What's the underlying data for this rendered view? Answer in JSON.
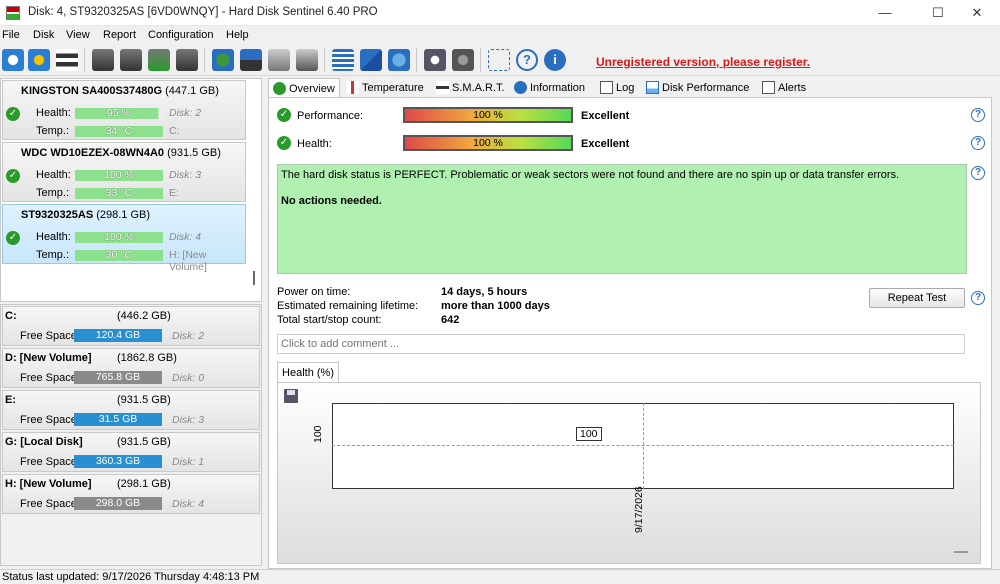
{
  "window": {
    "title": "Disk: 4, ST9320325AS [6VD0WNQY]  -  Hard Disk Sentinel 6.40 PRO",
    "minimize": "—",
    "maximize": "☐",
    "close": "✕"
  },
  "menu": [
    {
      "label": "File"
    },
    {
      "label": "Disk"
    },
    {
      "label": "View"
    },
    {
      "label": "Report"
    },
    {
      "label": "Configuration"
    },
    {
      "label": "Help"
    }
  ],
  "toolbar": {
    "unregistered": "Unregistered version, please register.",
    "icons": [
      "refresh-icon",
      "refresh-warning-icon",
      "disk-list-icon",
      "disk-info-icon",
      "disk-schedule-icon",
      "disk-test-icon",
      "disk-report-icon",
      "web-report-icon",
      "eject-icon",
      "usb-disk-icon",
      "external-disk-icon",
      "report-icon",
      "email-icon",
      "network-icon",
      "settings-icon",
      "sound-icon",
      "screenshot-icon",
      "help-icon",
      "about-icon"
    ]
  },
  "disks": [
    {
      "name": "KINGSTON SA400S37480G",
      "size": "(447.1 GB)",
      "health": "95 %",
      "health_pct": 95,
      "temp": "34 °C",
      "disk": "Disk: 2",
      "vol": "C:",
      "vol_italic": false
    },
    {
      "name": "WDC WD10EZEX-08WN4A0",
      "size": "(931.5 GB)",
      "health": "100 %",
      "health_pct": 100,
      "temp": "33 °C",
      "disk": "Disk: 3",
      "vol": "E:",
      "vol_italic": false
    },
    {
      "name": "ST9320325AS",
      "size": "(298.1 GB)",
      "health": "100 %",
      "health_pct": 100,
      "temp": "30 °C",
      "disk": "Disk: 4",
      "vol": "H: [New Volume]",
      "vol_italic": false
    }
  ],
  "labels": {
    "health": "Health:",
    "temp": "Temp.:",
    "free": "Free Space"
  },
  "volumes": [
    {
      "name": "C:",
      "size": "(446.2 GB)",
      "free": "120.4 GB",
      "disk": "Disk: 2",
      "color": "#2a8fd0"
    },
    {
      "name": "D: [New Volume]",
      "size": "(1862.8 GB)",
      "free": "765.8 GB",
      "disk": "Disk: 0",
      "color": "#8a8a8a"
    },
    {
      "name": "E:",
      "size": "(931.5 GB)",
      "free": "31.5 GB",
      "disk": "Disk: 3",
      "color": "#2a8fd0"
    },
    {
      "name": "G: [Local Disk]",
      "size": "(931.5 GB)",
      "free": "360.3 GB",
      "disk": "Disk: 1",
      "color": "#2a8fd0"
    },
    {
      "name": "H: [New Volume]",
      "size": "(298.1 GB)",
      "free": "298.0 GB",
      "disk": "Disk: 4",
      "color": "#8a8a8a"
    }
  ],
  "tabs": [
    {
      "label": "Overview",
      "icon": "check-icon"
    },
    {
      "label": "Temperature",
      "icon": "thermometer-icon"
    },
    {
      "label": "S.M.A.R.T.",
      "icon": "smart-icon"
    },
    {
      "label": "Information",
      "icon": "info-icon"
    },
    {
      "label": "Log",
      "icon": "log-icon"
    },
    {
      "label": "Disk Performance",
      "icon": "performance-icon"
    },
    {
      "label": "Alerts",
      "icon": "alerts-icon"
    }
  ],
  "overview": {
    "performance_label": "Performance:",
    "performance_value": "100 %",
    "performance_text": "Excellent",
    "health_label": "Health:",
    "health_value": "100 %",
    "health_text": "Excellent",
    "status_text": "The hard disk status is PERFECT. Problematic or weak sectors were not found and there are no spin up or data transfer errors.",
    "actions_text": "No actions needed.",
    "power_on_label": "Power on time:",
    "power_on_value": "14 days, 5 hours",
    "lifetime_label": "Estimated remaining lifetime:",
    "lifetime_value": "more than 1000 days",
    "startstop_label": "Total start/stop count:",
    "startstop_value": "642",
    "repeat_button": "Repeat Test",
    "comment_placeholder": "Click to add comment ...",
    "help": "?"
  },
  "chart_data": {
    "type": "line",
    "tab": "Health (%)",
    "x": [
      "9/17/2026"
    ],
    "series": [
      {
        "values": [
          100
        ]
      }
    ],
    "ylabel": "",
    "y_tick": "100",
    "data_label": "100"
  },
  "status": "Status last updated: 9/17/2026 Thursday 4:48:13 PM"
}
